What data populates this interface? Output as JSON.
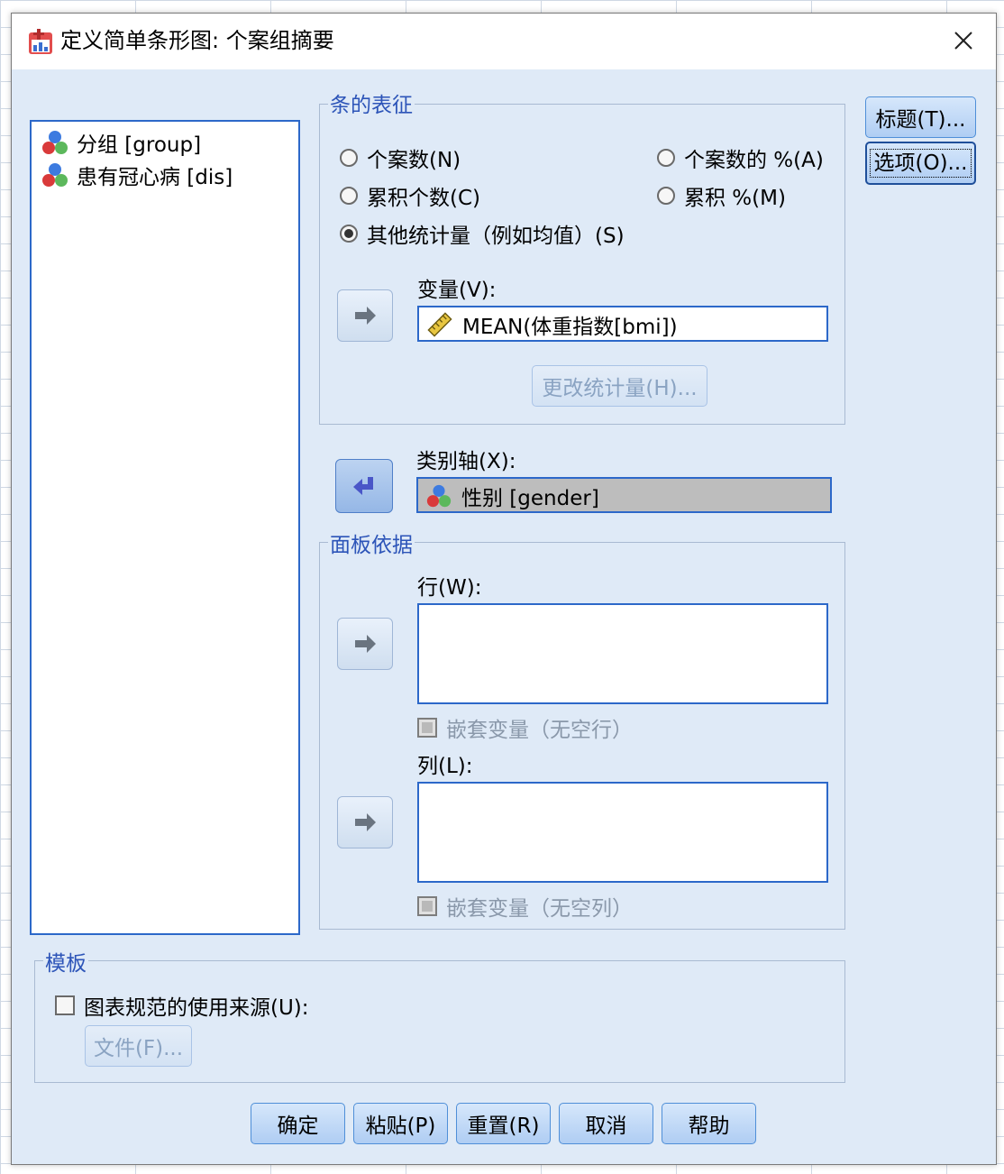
{
  "window": {
    "title": "定义简单条形图: 个案组摘要"
  },
  "variable_list": [
    {
      "label": "分组 [group]",
      "icon": "nominal-variable-icon"
    },
    {
      "label": "患有冠心病 [dis]",
      "icon": "nominal-variable-icon"
    }
  ],
  "bars_represent": {
    "legend": "条的表征",
    "options": [
      {
        "label": "个案数(N)",
        "selected": false
      },
      {
        "label": "个案数的 %(A)",
        "selected": false
      },
      {
        "label": "累积个数(C)",
        "selected": false
      },
      {
        "label": "累积 %(M)",
        "selected": false
      },
      {
        "label": "其他统计量（例如均值）(S)",
        "selected": true
      }
    ],
    "variable_label": "变量(V):",
    "variable_value": "MEAN(体重指数[bmi])",
    "change_stat_button": "更改统计量(H)..."
  },
  "category_axis": {
    "label": "类别轴(X):",
    "value": "性别 [gender]"
  },
  "panel_by": {
    "legend": "面板依据",
    "rows_label": "行(W):",
    "rows_nest_checkbox": "嵌套变量（无空行）",
    "cols_label": "列(L):",
    "cols_nest_checkbox": "嵌套变量（无空列）"
  },
  "template": {
    "legend": "模板",
    "use_checkbox": "图表规范的使用来源(U):",
    "file_button": "文件(F)..."
  },
  "side_buttons": {
    "titles": "标题(T)...",
    "options": "选项(O)..."
  },
  "bottom_buttons": {
    "ok": "确定",
    "paste": "粘贴(P)",
    "reset": "重置(R)",
    "cancel": "取消",
    "help": "帮助"
  },
  "colors": {
    "dialog_bg": "#dfeaf7",
    "field_border": "#2c68c9",
    "legend_text": "#2c54b8"
  }
}
